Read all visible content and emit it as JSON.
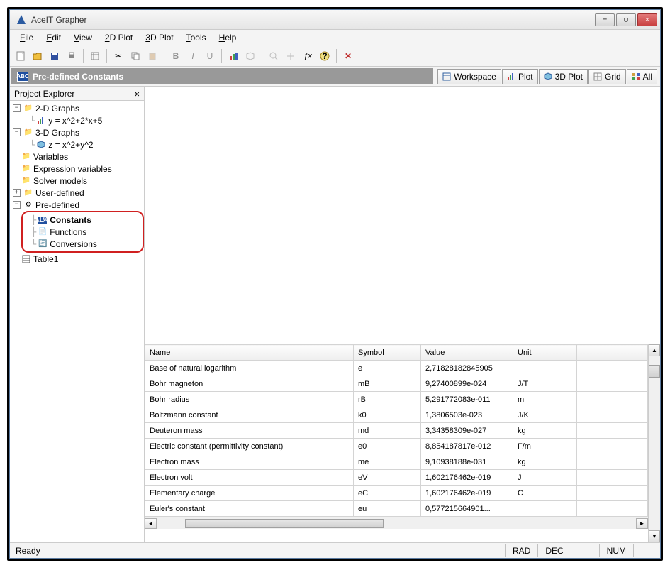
{
  "app": {
    "title": "AceIT Grapher"
  },
  "menu": {
    "file": "File",
    "edit": "Edit",
    "view": "View",
    "plot2d": "2D Plot",
    "plot3d": "3D Plot",
    "tools": "Tools",
    "help": "Help"
  },
  "subheader": {
    "title": "Pre-defined Constants"
  },
  "views": {
    "workspace": "Workspace",
    "plot": "Plot",
    "plot3d": "3D Plot",
    "grid": "Grid",
    "all": "All"
  },
  "sidebar": {
    "title": "Project Explorer",
    "tree": {
      "graphs2d": {
        "label": "2-D Graphs",
        "items": [
          "y = x^2+2*x+5"
        ]
      },
      "graphs3d": {
        "label": "3-D Graphs",
        "items": [
          "z = x^2+y^2"
        ]
      },
      "variables": "Variables",
      "exprvars": "Expression variables",
      "solver": "Solver models",
      "userdef": "User-defined",
      "predef": {
        "label": "Pre-defined",
        "constants": "Constants",
        "functions": "Functions",
        "conversions": "Conversions"
      },
      "table1": "Table1"
    }
  },
  "table": {
    "headers": {
      "name": "Name",
      "symbol": "Symbol",
      "value": "Value",
      "unit": "Unit"
    },
    "rows": [
      {
        "name": "Base of natural logarithm",
        "symbol": "e",
        "value": "2,71828182845905",
        "unit": ""
      },
      {
        "name": "Bohr magneton",
        "symbol": "mB",
        "value": "9,27400899e-024",
        "unit": "J/T"
      },
      {
        "name": "Bohr radius",
        "symbol": "rB",
        "value": "5,291772083e-011",
        "unit": "m"
      },
      {
        "name": "Boltzmann constant",
        "symbol": "k0",
        "value": "1,3806503e-023",
        "unit": "J/K"
      },
      {
        "name": "Deuteron mass",
        "symbol": "md",
        "value": "3,34358309e-027",
        "unit": "kg"
      },
      {
        "name": "Electric constant (permittivity constant)",
        "symbol": "e0",
        "value": "8,854187817e-012",
        "unit": "F/m"
      },
      {
        "name": "Electron mass",
        "symbol": "me",
        "value": "9,10938188e-031",
        "unit": "kg"
      },
      {
        "name": "Electron volt",
        "symbol": "eV",
        "value": "1,602176462e-019",
        "unit": "J"
      },
      {
        "name": "Elementary charge",
        "symbol": "eC",
        "value": "1,602176462e-019",
        "unit": "C"
      },
      {
        "name": "Euler's constant",
        "symbol": "eu",
        "value": "0,577215664901...",
        "unit": ""
      }
    ]
  },
  "status": {
    "ready": "Ready",
    "rad": "RAD",
    "dec": "DEC",
    "num": "NUM"
  }
}
